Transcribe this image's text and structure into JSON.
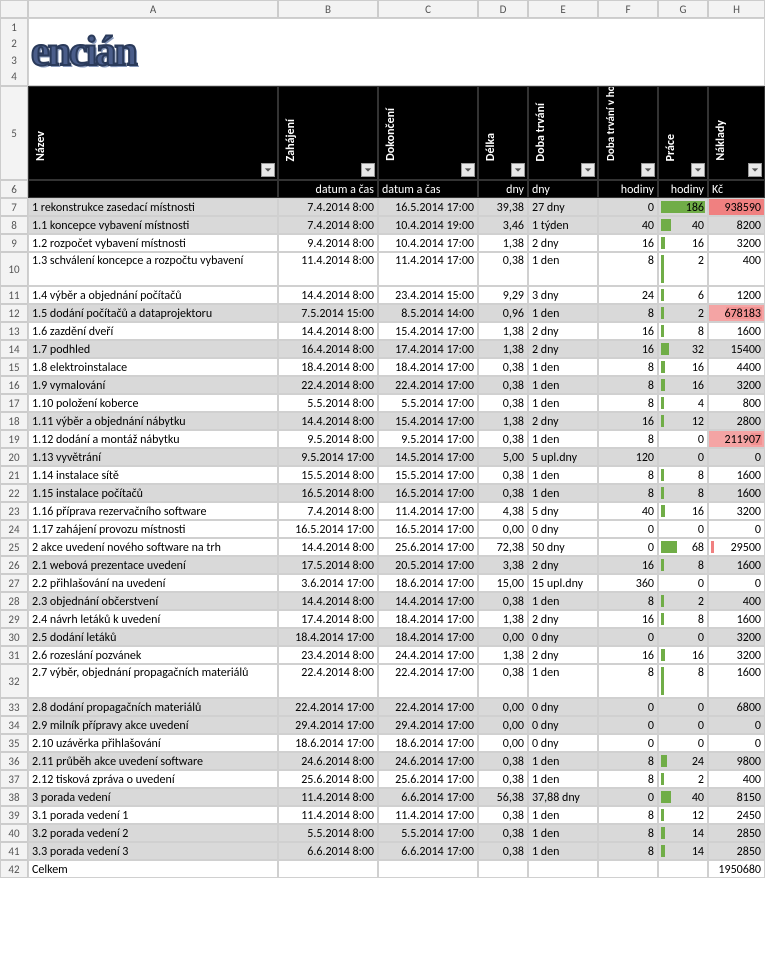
{
  "logo_text": "encián",
  "cols": [
    "A",
    "B",
    "C",
    "D",
    "E",
    "F",
    "G",
    "H"
  ],
  "row_labels_merged": [
    "1",
    "2",
    "3",
    "4"
  ],
  "header_row": {
    "rownum": "5",
    "labels": [
      "Název",
      "Zahájení",
      "Dokončení",
      "Délka",
      "Doba trvání",
      "Doba trvání v hodinách",
      "Práce",
      "Náklady"
    ]
  },
  "units_row": {
    "rownum": "6",
    "cells": [
      "",
      "datum a čas",
      "datum a čas",
      "dny",
      "dny",
      "hodiny",
      "hodiny",
      "Kč"
    ]
  },
  "chart_data": {
    "type": "table",
    "columns": [
      "row",
      "Název",
      "Zahájení",
      "Dokončení",
      "Délka (dny)",
      "Doba trvání",
      "Doba trvání v hodinách",
      "Práce (hodiny)",
      "Náklady (Kč)"
    ],
    "rows": [
      {
        "row": "7",
        "gray": true,
        "tall": false,
        "a": "1 rekonstrukce zasedací místnosti",
        "b": "7.4.2014 8:00",
        "c": "16.5.2014 17:00",
        "d": "39,38",
        "e": "27 dny",
        "f": "0",
        "g": "186",
        "g_bar": 100,
        "h": "938590",
        "h_cls": "bg-red",
        "h_red": 100
      },
      {
        "row": "8",
        "gray": true,
        "tall": false,
        "a": "1.1 koncepce vybavení místnosti",
        "b": "7.4.2014 8:00",
        "c": "10.4.2014 19:00",
        "d": "3,46",
        "e": "1 týden",
        "f": "40",
        "g": "40",
        "g_bar": 22,
        "h": "8200"
      },
      {
        "row": "9",
        "gray": false,
        "tall": false,
        "a": "1.2 rozpočet vybavení místnosti",
        "b": "9.4.2014 8:00",
        "c": "10.4.2014 17:00",
        "d": "1,38",
        "e": "2 dny",
        "f": "16",
        "g": "16",
        "g_bar": 9,
        "h": "3200"
      },
      {
        "row": "10",
        "gray": false,
        "tall": true,
        "a": "1.3 schválení koncepce a rozpočtu vybavení",
        "b": "11.4.2014 8:00",
        "c": "11.4.2014 17:00",
        "d": "0,38",
        "e": "1 den",
        "f": "8",
        "g": "2",
        "g_bar": 2,
        "h": "400"
      },
      {
        "row": "11",
        "gray": false,
        "tall": false,
        "a": "1.4 výběr a objednání počítačů",
        "b": "14.4.2014 8:00",
        "c": "23.4.2014 15:00",
        "d": "9,29",
        "e": "3 dny",
        "f": "24",
        "g": "6",
        "g_bar": 4,
        "h": "1200"
      },
      {
        "row": "12",
        "gray": true,
        "tall": false,
        "a": "1.5 dodání počítačů a dataprojektoru",
        "b": "7.5.2014 15:00",
        "c": "8.5.2014 14:00",
        "d": "0,96",
        "e": "1 den",
        "f": "8",
        "g": "2",
        "g_bar": 2,
        "h": "678183",
        "h_cls": "bg-red-lt",
        "h_red": 72
      },
      {
        "row": "13",
        "gray": false,
        "tall": false,
        "a": "1.6 zazdění dveří",
        "b": "14.4.2014 8:00",
        "c": "15.4.2014 17:00",
        "d": "1,38",
        "e": "2 dny",
        "f": "16",
        "g": "8",
        "g_bar": 5,
        "h": "1600"
      },
      {
        "row": "14",
        "gray": true,
        "tall": false,
        "a": "1.7 podhled",
        "b": "16.4.2014 8:00",
        "c": "17.4.2014 17:00",
        "d": "1,38",
        "e": "2 dny",
        "f": "16",
        "g": "32",
        "g_bar": 18,
        "h": "15400"
      },
      {
        "row": "15",
        "gray": false,
        "tall": false,
        "a": "1.8 elektroinstalace",
        "b": "18.4.2014 8:00",
        "c": "18.4.2014 17:00",
        "d": "0,38",
        "e": "1 den",
        "f": "8",
        "g": "16",
        "g_bar": 9,
        "h": "4400"
      },
      {
        "row": "16",
        "gray": true,
        "tall": false,
        "a": "1.9 vymalování",
        "b": "22.4.2014 8:00",
        "c": "22.4.2014 17:00",
        "d": "0,38",
        "e": "1 den",
        "f": "8",
        "g": "16",
        "g_bar": 9,
        "h": "3200"
      },
      {
        "row": "17",
        "gray": false,
        "tall": false,
        "a": "1.10 položení koberce",
        "b": "5.5.2014 8:00",
        "c": "5.5.2014 17:00",
        "d": "0,38",
        "e": "1 den",
        "f": "8",
        "g": "4",
        "g_bar": 3,
        "h": "800"
      },
      {
        "row": "18",
        "gray": true,
        "tall": false,
        "a": "1.11 výběr a objednání nábytku",
        "b": "14.4.2014 8:00",
        "c": "15.4.2014 17:00",
        "d": "1,38",
        "e": "2 dny",
        "f": "16",
        "g": "12",
        "g_bar": 7,
        "h": "2800"
      },
      {
        "row": "19",
        "gray": false,
        "tall": false,
        "a": "1.12 dodání a montáž nábytku",
        "b": "9.5.2014 8:00",
        "c": "9.5.2014 17:00",
        "d": "0,38",
        "e": "1 den",
        "f": "8",
        "g": "0",
        "g_bar": 0,
        "h": "211907",
        "h_cls": "bg-red-lt",
        "h_red": 22
      },
      {
        "row": "20",
        "gray": true,
        "tall": false,
        "a": "1.13 vyvětrání",
        "b": "9.5.2014 17:00",
        "c": "14.5.2014 17:00",
        "d": "5,00",
        "e": "5 upl.dny",
        "f": "120",
        "g": "0",
        "g_bar": 0,
        "h": "0"
      },
      {
        "row": "21",
        "gray": false,
        "tall": false,
        "a": "1.14 instalace sítě",
        "b": "15.5.2014 8:00",
        "c": "15.5.2014 17:00",
        "d": "0,38",
        "e": "1 den",
        "f": "8",
        "g": "8",
        "g_bar": 5,
        "h": "1600"
      },
      {
        "row": "22",
        "gray": true,
        "tall": false,
        "a": "1.15 instalace počítačů",
        "b": "16.5.2014 8:00",
        "c": "16.5.2014 17:00",
        "d": "0,38",
        "e": "1 den",
        "f": "8",
        "g": "8",
        "g_bar": 5,
        "h": "1600"
      },
      {
        "row": "23",
        "gray": false,
        "tall": false,
        "a": "1.16 příprava rezervačního software",
        "b": "7.4.2014 8:00",
        "c": "11.4.2014 17:00",
        "d": "4,38",
        "e": "5 dny",
        "f": "40",
        "g": "16",
        "g_bar": 9,
        "h": "3200"
      },
      {
        "row": "24",
        "gray": false,
        "tall": false,
        "a": "1.17 zahájení provozu místnosti",
        "b": "16.5.2014 17:00",
        "c": "16.5.2014 17:00",
        "d": "0,00",
        "e": "0 dny",
        "f": "0",
        "g": "0",
        "g_bar": 0,
        "h": "0"
      },
      {
        "row": "25",
        "gray": false,
        "tall": false,
        "a": "2 akce uvedení nového software na trh",
        "b": "14.4.2014 8:00",
        "c": "25.6.2014 17:00",
        "d": "72,38",
        "e": "50 dny",
        "f": "0",
        "g": "68",
        "g_bar": 37,
        "h": "29500",
        "h_redtip": true
      },
      {
        "row": "26",
        "gray": true,
        "tall": false,
        "a": "2.1 webová prezentace uvedení",
        "b": "17.5.2014 8:00",
        "c": "20.5.2014 17:00",
        "d": "3,38",
        "e": "2 dny",
        "f": "16",
        "g": "8",
        "g_bar": 5,
        "h": "1600"
      },
      {
        "row": "27",
        "gray": false,
        "tall": false,
        "a": "2.2 přihlašování na uvedení",
        "b": "3.6.2014 17:00",
        "c": "18.6.2014 17:00",
        "d": "15,00",
        "e": "15 upl.dny",
        "f": "360",
        "g": "0",
        "g_bar": 0,
        "h": "0"
      },
      {
        "row": "28",
        "gray": true,
        "tall": false,
        "a": "2.3 objednání občerstvení",
        "b": "14.4.2014 8:00",
        "c": "14.4.2014 17:00",
        "d": "0,38",
        "e": "1 den",
        "f": "8",
        "g": "2",
        "g_bar": 2,
        "h": "400"
      },
      {
        "row": "29",
        "gray": false,
        "tall": false,
        "a": "2.4 návrh letáků k uvedení",
        "b": "17.4.2014 8:00",
        "c": "18.4.2014 17:00",
        "d": "1,38",
        "e": "2 dny",
        "f": "16",
        "g": "8",
        "g_bar": 5,
        "h": "1600"
      },
      {
        "row": "30",
        "gray": true,
        "tall": false,
        "a": "2.5 dodání letáků",
        "b": "18.4.2014 17:00",
        "c": "18.4.2014 17:00",
        "d": "0,00",
        "e": "0 dny",
        "f": "0",
        "g": "0",
        "g_bar": 0,
        "h": "3200"
      },
      {
        "row": "31",
        "gray": false,
        "tall": false,
        "a": "2.6 rozeslání pozvánek",
        "b": "23.4.2014 8:00",
        "c": "24.4.2014 17:00",
        "d": "1,38",
        "e": "2 dny",
        "f": "16",
        "g": "16",
        "g_bar": 9,
        "h": "3200"
      },
      {
        "row": "32",
        "gray": false,
        "tall": true,
        "a": "2.7 výběr, objednání propagačních materiálů",
        "b": "22.4.2014 8:00",
        "c": "22.4.2014 17:00",
        "d": "0,38",
        "e": "1 den",
        "f": "8",
        "g": "8",
        "g_bar": 5,
        "h": "1600"
      },
      {
        "row": "33",
        "gray": true,
        "tall": false,
        "a": "2.8 dodání propagačních materiálů",
        "b": "22.4.2014 17:00",
        "c": "22.4.2014 17:00",
        "d": "0,00",
        "e": "0 dny",
        "f": "0",
        "g": "0",
        "g_bar": 0,
        "h": "6800"
      },
      {
        "row": "34",
        "gray": true,
        "tall": false,
        "a": "2.9 milník přípravy akce uvedení",
        "b": "29.4.2014 17:00",
        "c": "29.4.2014 17:00",
        "d": "0,00",
        "e": "0 dny",
        "f": "0",
        "g": "0",
        "g_bar": 0,
        "h": "0"
      },
      {
        "row": "35",
        "gray": false,
        "tall": false,
        "a": "2.10 uzávěrka přihlašování",
        "b": "18.6.2014 17:00",
        "c": "18.6.2014 17:00",
        "d": "0,00",
        "e": "0 dny",
        "f": "0",
        "g": "0",
        "g_bar": 0,
        "h": "0"
      },
      {
        "row": "36",
        "gray": true,
        "tall": false,
        "a": "2.11 průběh akce uvedení software",
        "b": "24.6.2014 8:00",
        "c": "24.6.2014 17:00",
        "d": "0,38",
        "e": "1 den",
        "f": "8",
        "g": "24",
        "g_bar": 13,
        "h": "9800"
      },
      {
        "row": "37",
        "gray": false,
        "tall": false,
        "a": "2.12 tisková zpráva o uvedení",
        "b": "25.6.2014 8:00",
        "c": "25.6.2014 17:00",
        "d": "0,38",
        "e": "1 den",
        "f": "8",
        "g": "2",
        "g_bar": 2,
        "h": "400"
      },
      {
        "row": "38",
        "gray": true,
        "tall": false,
        "a": "3 porada vedení",
        "b": "11.4.2014 8:00",
        "c": "6.6.2014 17:00",
        "d": "56,38",
        "e": "37,88 dny",
        "f": "0",
        "g": "40",
        "g_bar": 22,
        "h": "8150"
      },
      {
        "row": "39",
        "gray": false,
        "tall": false,
        "a": "3.1 porada vedení 1",
        "b": "11.4.2014 8:00",
        "c": "11.4.2014 17:00",
        "d": "0,38",
        "e": "1 den",
        "f": "8",
        "g": "12",
        "g_bar": 7,
        "h": "2450"
      },
      {
        "row": "40",
        "gray": true,
        "tall": false,
        "a": "3.2 porada vedení 2",
        "b": "5.5.2014 8:00",
        "c": "5.5.2014 17:00",
        "d": "0,38",
        "e": "1 den",
        "f": "8",
        "g": "14",
        "g_bar": 8,
        "h": "2850"
      },
      {
        "row": "41",
        "gray": true,
        "tall": false,
        "a": "3.3 porada vedení 3",
        "b": "6.6.2014 8:00",
        "c": "6.6.2014 17:00",
        "d": "0,38",
        "e": "1 den",
        "f": "8",
        "g": "14",
        "g_bar": 8,
        "h": "2850"
      }
    ],
    "total_row": {
      "row": "42",
      "label": "Celkem",
      "value": "1950680"
    }
  }
}
